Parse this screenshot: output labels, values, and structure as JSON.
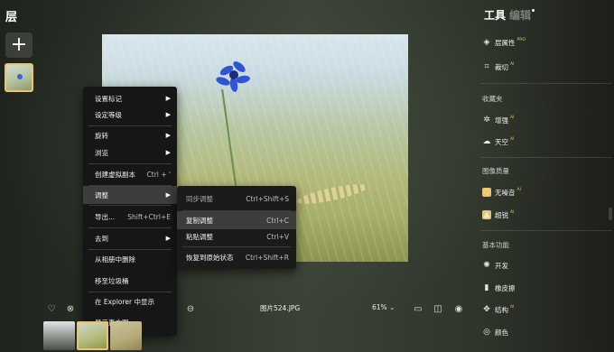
{
  "left_panel": {
    "title": "层",
    "add_icon": "plus-icon"
  },
  "context_menu": {
    "items": [
      {
        "label": "设置标记",
        "has_submenu": true
      },
      {
        "label": "设定等级",
        "has_submenu": true
      },
      {
        "label": "旋转",
        "has_submenu": true
      },
      {
        "label": "浏览",
        "has_submenu": true
      },
      {
        "label": "创建虚拟副本",
        "shortcut": "Ctrl + '"
      },
      {
        "label": "调整",
        "has_submenu": true,
        "highlighted": true
      },
      {
        "label": "导出...",
        "shortcut": "Shift+Ctrl+E"
      },
      {
        "label": "去到",
        "has_submenu": true
      },
      {
        "label": "从相册中删除"
      },
      {
        "label": "移至垃圾桶"
      },
      {
        "label": "在 Explorer 中显示"
      },
      {
        "label": "显示直方图"
      }
    ],
    "arrow_glyph": "▶"
  },
  "submenu": {
    "items": [
      {
        "label": "同步调整",
        "shortcut": "Ctrl+Shift+S",
        "dim": true
      },
      {
        "label": "复制调整",
        "shortcut": "Ctrl+C",
        "highlighted": true
      },
      {
        "label": "粘贴调整",
        "shortcut": "Ctrl+V"
      },
      {
        "label": "恢复到原始状态",
        "shortcut": "Ctrl+Shift+R"
      }
    ]
  },
  "bottom_bar": {
    "filename": "图片524.JPG",
    "zoom": "61%",
    "zoom_caret": "⌄",
    "icons": [
      "heart-icon",
      "reject-icon",
      "minus-circle-icon",
      "compare-icon",
      "split-view-icon",
      "eye-icon"
    ]
  },
  "right_panel": {
    "tab_tools": "工具",
    "tab_edit": "编辑",
    "items": [
      {
        "label": "层属性",
        "badge": "PRO",
        "icon": "layers-icon"
      },
      {
        "label": "裁切",
        "badge": "AI",
        "icon": "crop-icon"
      },
      {
        "section": "收藏夹"
      },
      {
        "label": "增强",
        "badge": "AI",
        "icon": "sparkle-icon"
      },
      {
        "label": "天空",
        "badge": "AI",
        "icon": "cloud-icon"
      },
      {
        "section": "图像质量"
      },
      {
        "label": "无噪音",
        "badge": "AI",
        "icon": "denoise-icon"
      },
      {
        "label": "超锐",
        "badge": "AI",
        "icon": "sharpen-icon"
      },
      {
        "section": "基本功能"
      },
      {
        "label": "开发",
        "icon": "sun-icon"
      },
      {
        "label": "橡皮擦",
        "icon": "eraser-icon"
      },
      {
        "label": "结构",
        "badge": "AI",
        "icon": "structure-icon"
      },
      {
        "label": "颜色",
        "icon": "color-icon"
      }
    ],
    "accent": "#e9c46a"
  }
}
